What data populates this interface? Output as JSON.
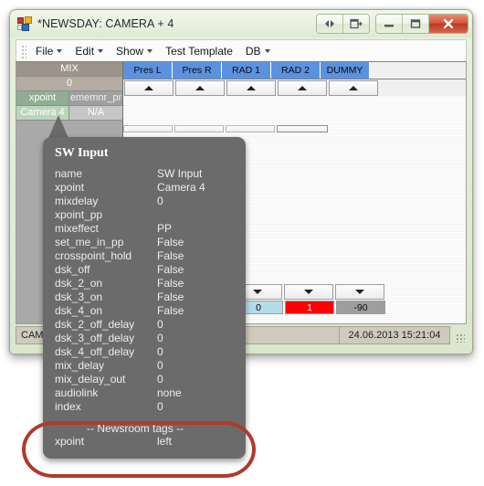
{
  "window": {
    "title": "*NEWSDAY: CAMERA + 4",
    "icon": "app-icon",
    "buttons": [
      {
        "name": "prev-next-button",
        "glyph": "◀▶"
      },
      {
        "name": "restore-group-button",
        "glyph": "▤"
      },
      {
        "name": "minimize-button",
        "glyph": "—"
      },
      {
        "name": "maximize-button",
        "glyph": "▣"
      },
      {
        "name": "close-button",
        "glyph": "X"
      }
    ]
  },
  "menu": {
    "items": [
      {
        "label": "File",
        "has_caret": true
      },
      {
        "label": "Edit",
        "has_caret": true
      },
      {
        "label": "Show",
        "has_caret": true
      },
      {
        "label": "Test Template",
        "has_caret": false
      },
      {
        "label": "DB",
        "has_caret": true
      }
    ]
  },
  "row_header": {
    "title": "MIX",
    "subtitle": "0",
    "rows": [
      {
        "left": "xpoint",
        "right": "ememnr_pr"
      },
      {
        "left": "Camera 4",
        "right": "N/A"
      }
    ]
  },
  "grid": {
    "columns": [
      "Pres L",
      "Pres R",
      "RAD 1",
      "RAD 2",
      "DUMMY"
    ],
    "header_color": "#5b92e0",
    "value_row": [
      {
        "value": "0",
        "color": "#b6dbe8",
        "style": "val-blue"
      },
      {
        "value": "1",
        "color": "#fe0000",
        "style": "val-red"
      },
      {
        "value": "-90",
        "color": "#9e9e9e",
        "style": "val-gray"
      }
    ]
  },
  "status_bar": {
    "left": "CAM",
    "middle": "",
    "datetime": "24.06.2013 15:21:04"
  },
  "tooltip": {
    "title": "SW Input",
    "rows": [
      {
        "key": "name",
        "value": "SW Input"
      },
      {
        "key": "xpoint",
        "value": "Camera 4"
      },
      {
        "key": "mixdelay",
        "value": "0",
        "value_inline": true
      },
      {
        "key": "xpoint_pp",
        "value": ""
      },
      {
        "key": "mixeffect",
        "value": "PP"
      },
      {
        "key": "set_me_in_pp",
        "value": "False"
      },
      {
        "key": "crosspoint_hold",
        "value": "False"
      },
      {
        "key": "dsk_off",
        "value": "False"
      },
      {
        "key": "dsk_2_on",
        "value": "False"
      },
      {
        "key": "dsk_3_on",
        "value": "False"
      },
      {
        "key": "dsk_4_on",
        "value": "False"
      },
      {
        "key": "dsk_2_off_delay",
        "value": "0"
      },
      {
        "key": "dsk_3_off_delay",
        "value": "0"
      },
      {
        "key": "dsk_4_off_delay",
        "value": "0"
      },
      {
        "key": "mix_delay",
        "value": "0"
      },
      {
        "key": "mix_delay_out",
        "value": "0"
      },
      {
        "key": "audiolink",
        "value": "none"
      },
      {
        "key": "index",
        "value": "0"
      }
    ],
    "section_label": "-- Newsroom tags --",
    "section_rows": [
      {
        "key": "xpoint",
        "value": "left"
      }
    ]
  },
  "annotation": {
    "shape": "oval",
    "color": "#b03a2a"
  }
}
